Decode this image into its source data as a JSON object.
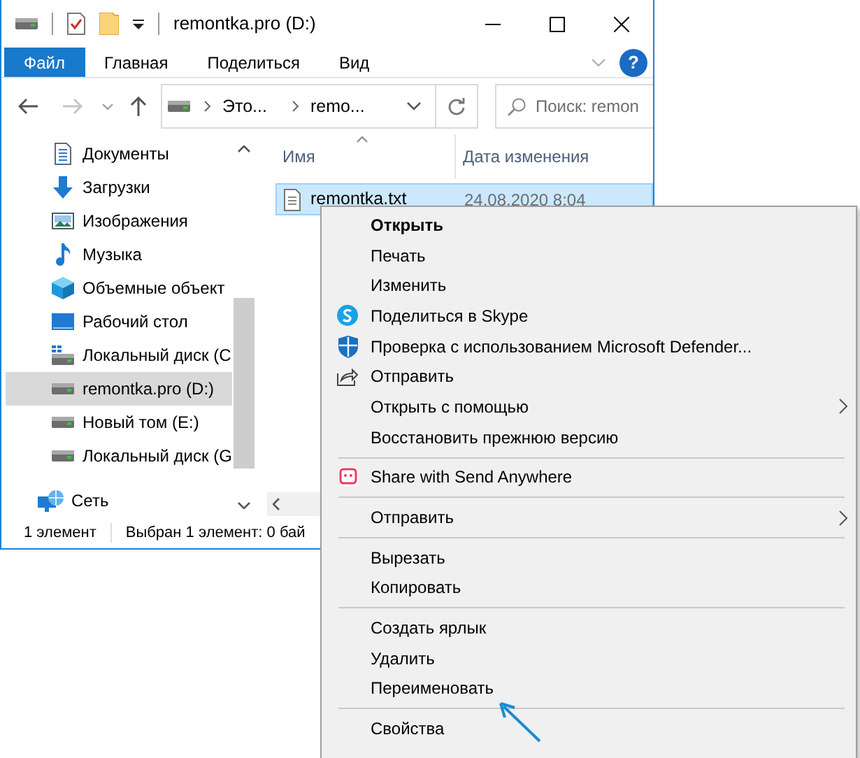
{
  "window": {
    "title": "remontka.pro (D:)"
  },
  "ribbon": {
    "tabs": [
      {
        "label": "Файл",
        "selected": true
      },
      {
        "label": "Главная",
        "selected": false
      },
      {
        "label": "Поделиться",
        "selected": false
      },
      {
        "label": "Вид",
        "selected": false
      }
    ],
    "help_button": {
      "label": "?"
    }
  },
  "address_bar": {
    "segments": [
      "Это...",
      "remo..."
    ]
  },
  "search": {
    "placeholder": "Поиск: remon"
  },
  "nav_pane": {
    "items": [
      {
        "label": "Документы",
        "selected": false
      },
      {
        "label": "Загрузки",
        "selected": false
      },
      {
        "label": "Изображения",
        "selected": false
      },
      {
        "label": "Музыка",
        "selected": false
      },
      {
        "label": "Объемные объект",
        "selected": false
      },
      {
        "label": "Рабочий стол",
        "selected": false
      },
      {
        "label": "Локальный диск (C",
        "selected": false
      },
      {
        "label": "remontka.pro (D:)",
        "selected": true
      },
      {
        "label": "Новый том (E:)",
        "selected": false
      },
      {
        "label": "Локальный диск (G",
        "selected": false
      }
    ],
    "network": {
      "label": "Сеть"
    }
  },
  "columns": [
    {
      "label": "Имя",
      "sorted": true
    },
    {
      "label": "Дата изменения",
      "sorted": false
    }
  ],
  "files": [
    {
      "name": "remontka.txt",
      "date": "24.08.2020 8:04",
      "selected": true
    }
  ],
  "status_bar": {
    "count": "1 элемент",
    "selection": "Выбран 1 элемент: 0 бай"
  },
  "context_menu": {
    "items": [
      {
        "kind": "item",
        "label": "Открыть",
        "default": true,
        "submenu": false
      },
      {
        "kind": "item",
        "label": "Печать",
        "default": false,
        "submenu": false
      },
      {
        "kind": "item",
        "label": "Изменить",
        "default": false,
        "submenu": false
      },
      {
        "kind": "item",
        "label": "Поделиться в Skype",
        "default": false,
        "submenu": false
      },
      {
        "kind": "item",
        "label": "Проверка с использованием Microsoft Defender...",
        "default": false,
        "submenu": false
      },
      {
        "kind": "item",
        "label": "Отправить",
        "default": false,
        "submenu": false
      },
      {
        "kind": "item",
        "label": "Открыть с помощью",
        "default": false,
        "submenu": true
      },
      {
        "kind": "item",
        "label": "Восстановить прежнюю версию",
        "default": false,
        "submenu": false
      },
      {
        "kind": "separator"
      },
      {
        "kind": "item",
        "label": "Share with Send Anywhere",
        "default": false,
        "submenu": false
      },
      {
        "kind": "separator"
      },
      {
        "kind": "item",
        "label": "Отправить",
        "default": false,
        "submenu": true
      },
      {
        "kind": "separator"
      },
      {
        "kind": "item",
        "label": "Вырезать",
        "default": false,
        "submenu": false
      },
      {
        "kind": "item",
        "label": "Копировать",
        "default": false,
        "submenu": false
      },
      {
        "kind": "separator"
      },
      {
        "kind": "item",
        "label": "Создать ярлык",
        "default": false,
        "submenu": false
      },
      {
        "kind": "item",
        "label": "Удалить",
        "default": false,
        "submenu": false
      },
      {
        "kind": "item",
        "label": "Переименовать",
        "default": false,
        "submenu": false
      },
      {
        "kind": "separator"
      },
      {
        "kind": "item",
        "label": "Свойства",
        "default": false,
        "submenu": false
      }
    ]
  }
}
